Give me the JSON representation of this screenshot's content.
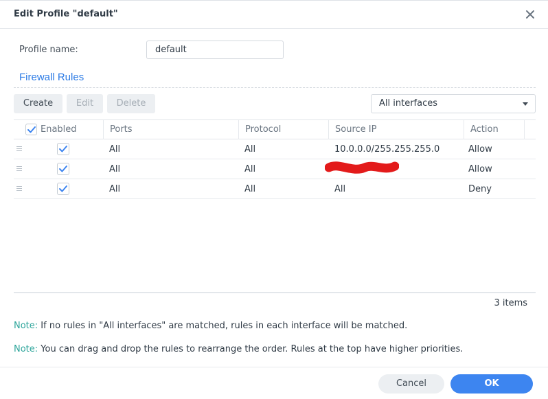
{
  "dialog": {
    "title": "Edit Profile \"default\"",
    "close_icon": "close-icon"
  },
  "profile": {
    "label": "Profile name:",
    "value": "default"
  },
  "section_title": "Firewall Rules",
  "toolbar": {
    "create_label": "Create",
    "edit_label": "Edit",
    "delete_label": "Delete",
    "interface_select": "All interfaces"
  },
  "table": {
    "columns": [
      "Enabled",
      "Ports",
      "Protocol",
      "Source IP",
      "Action"
    ],
    "rows": [
      {
        "enabled": true,
        "ports": "All",
        "protocol": "All",
        "source_ip": "10.0.0.0/255.255.255.0",
        "action": "Allow"
      },
      {
        "enabled": true,
        "ports": "All",
        "protocol": "All",
        "source_ip": "",
        "source_ip_redacted": true,
        "action": "Allow"
      },
      {
        "enabled": true,
        "ports": "All",
        "protocol": "All",
        "source_ip": "All",
        "action": "Deny"
      }
    ],
    "count": "3 items"
  },
  "notes": [
    {
      "prefix": "Note:",
      "text": "If no rules in \"All interfaces\" are matched, rules in each interface will be matched."
    },
    {
      "prefix": "Note:",
      "text": "You can drag and drop the rules to rearrange the order. Rules at the top have higher priorities."
    }
  ],
  "buttons": {
    "cancel_label": "Cancel",
    "ok_label": "OK"
  },
  "colors": {
    "accent": "#3d85f0",
    "section_title": "#2c7be5",
    "note_prefix": "#2da59b",
    "redaction": "#e31b1b"
  }
}
